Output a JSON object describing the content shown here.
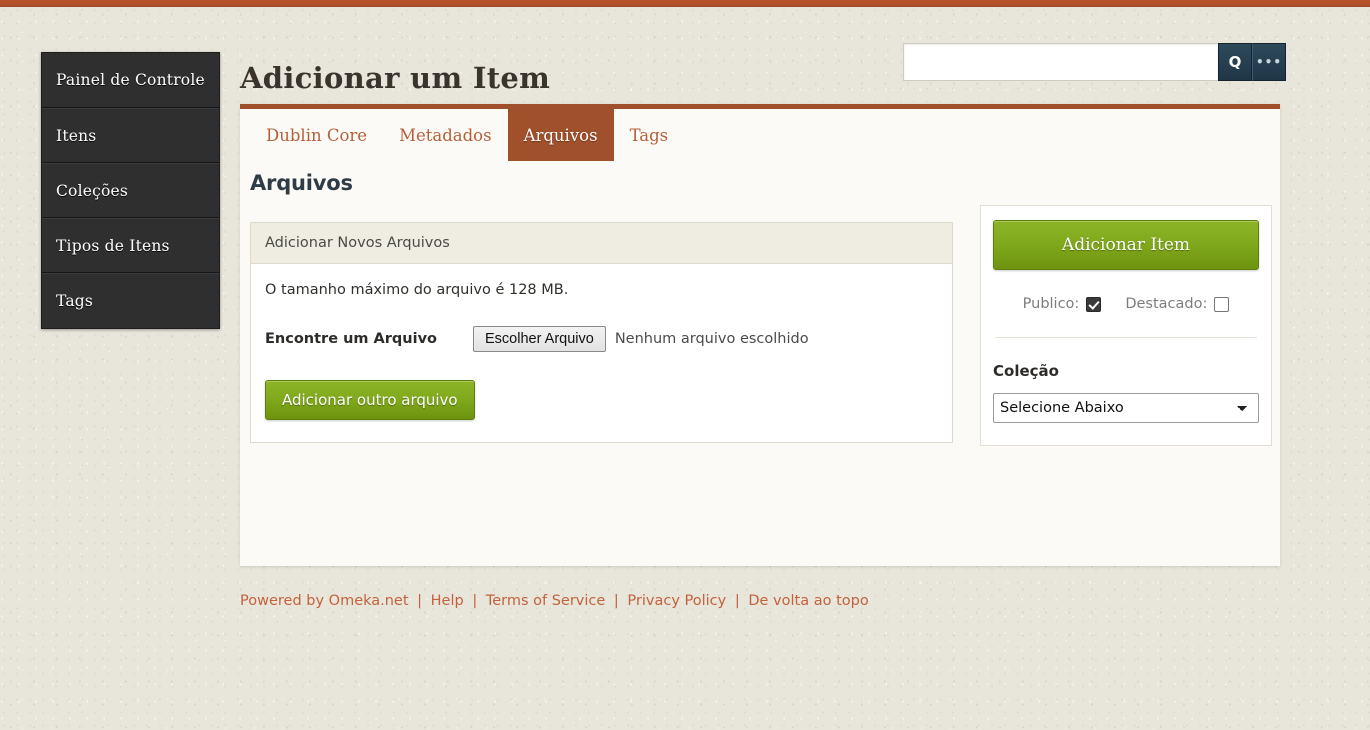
{
  "theme": {
    "accent_rust": "#a0512c",
    "link_orange": "#c2613c",
    "green_button": "#7fa81c",
    "sidebar_dark": "#2d2d2d",
    "page_background": "#e8e6da"
  },
  "sidebar": {
    "items": [
      {
        "label": "Painel de Controle"
      },
      {
        "label": "Itens"
      },
      {
        "label": "Coleções"
      },
      {
        "label": "Tipos de Itens"
      },
      {
        "label": "Tags"
      }
    ]
  },
  "header": {
    "title": "Adicionar um Item"
  },
  "search": {
    "value": "",
    "placeholder": "",
    "submit_icon": "search-icon",
    "submit_glyph": "Q",
    "advanced_icon": "ellipsis-icon",
    "advanced_glyph": "•••"
  },
  "tabs": [
    {
      "label": "Dublin Core",
      "active": false
    },
    {
      "label": "Metadados",
      "active": false
    },
    {
      "label": "Arquivos",
      "active": true
    },
    {
      "label": "Tags",
      "active": false
    }
  ],
  "main": {
    "section_title": "Arquivos",
    "fieldset": {
      "legend": "Adicionar Novos Arquivos",
      "max_size_note": "O tamanho máximo do arquivo é 128 MB.",
      "file_label": "Encontre um Arquivo",
      "choose_file_button": "Escolher Arquivo",
      "no_file_text": "Nenhum arquivo escolhido",
      "add_another_button": "Adicionar outro arquivo"
    }
  },
  "right_panel": {
    "add_item_button": "Adicionar Item",
    "checkboxes": [
      {
        "label": "Publico:",
        "checked": true
      },
      {
        "label": "Destacado:",
        "checked": false
      }
    ],
    "collection_label": "Coleção",
    "collection_selected": "Selecione Abaixo",
    "collection_options": [
      "Selecione Abaixo"
    ]
  },
  "footer": {
    "links": [
      "Powered by Omeka.net",
      "Help",
      "Terms of Service",
      "Privacy Policy",
      "De volta ao topo"
    ],
    "separator": "|"
  }
}
